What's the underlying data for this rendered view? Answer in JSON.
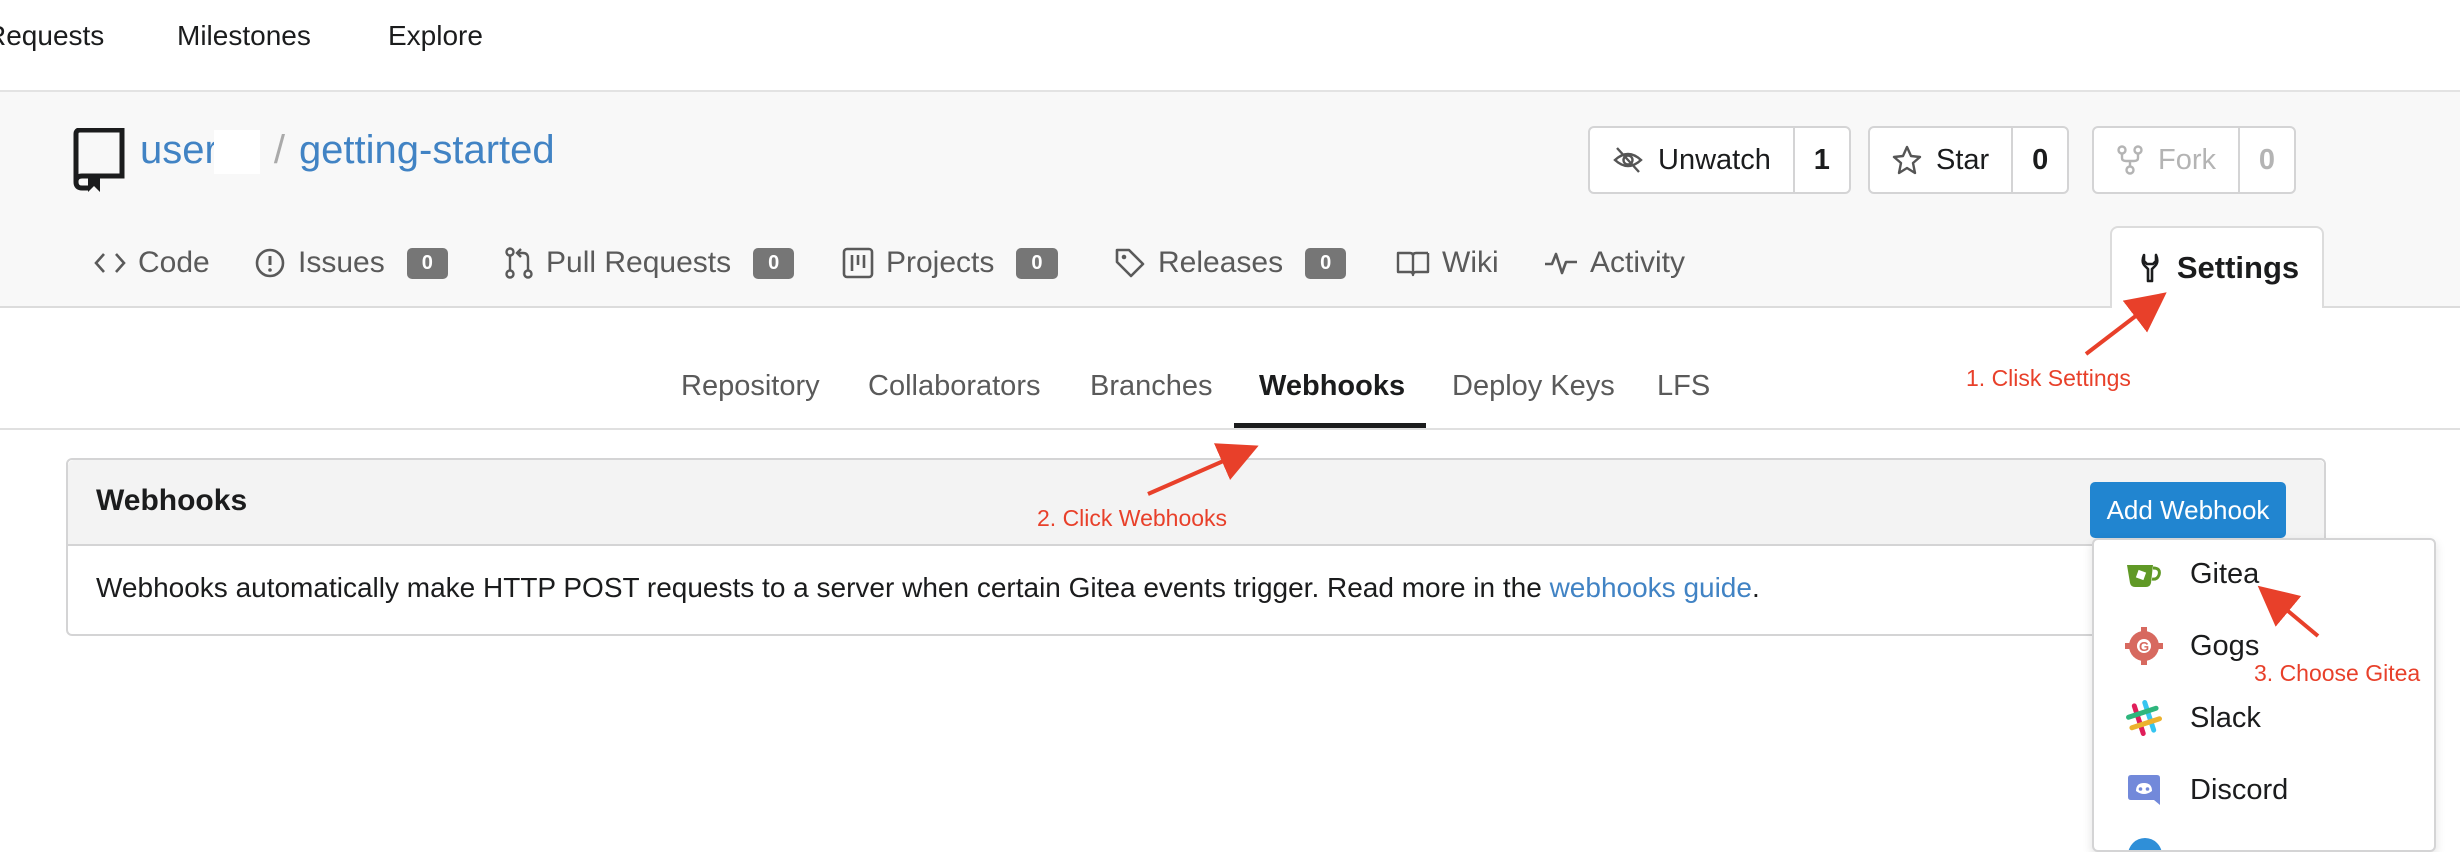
{
  "topnav": {
    "requests": "Requests",
    "milestones": "Milestones",
    "explore": "Explore"
  },
  "repo": {
    "owner": "user",
    "separator": "/",
    "name": "getting-started"
  },
  "actions": {
    "watch": {
      "label": "Unwatch",
      "count": "1"
    },
    "star": {
      "label": "Star",
      "count": "0"
    },
    "fork": {
      "label": "Fork",
      "count": "0"
    }
  },
  "tabs": {
    "code": "Code",
    "issues": {
      "label": "Issues",
      "count": "0"
    },
    "pulls": {
      "label": "Pull Requests",
      "count": "0"
    },
    "projects": {
      "label": "Projects",
      "count": "0"
    },
    "releases": {
      "label": "Releases",
      "count": "0"
    },
    "wiki": "Wiki",
    "activity": "Activity",
    "settings": "Settings"
  },
  "settings_nav": {
    "repository": "Repository",
    "collaborators": "Collaborators",
    "branches": "Branches",
    "webhooks": "Webhooks",
    "deploy_keys": "Deploy Keys",
    "lfs": "LFS"
  },
  "webhooks": {
    "title": "Webhooks",
    "add_button": "Add Webhook",
    "description": "Webhooks automatically make HTTP POST requests to a server when certain Gitea events trigger. Read more in the ",
    "guide_link": "webhooks guide",
    "end": "."
  },
  "dropdown": {
    "gitea": "Gitea",
    "gogs": "Gogs",
    "slack": "Slack",
    "discord": "Discord"
  },
  "annotations": {
    "step1": "1. Clisk Settings",
    "step2": "2. Click Webhooks",
    "step3": "3. Choose Gitea"
  },
  "colors": {
    "accent": "#2185d0",
    "link": "#4183c4",
    "annotation": "#e8402a",
    "badge": "#767676"
  }
}
